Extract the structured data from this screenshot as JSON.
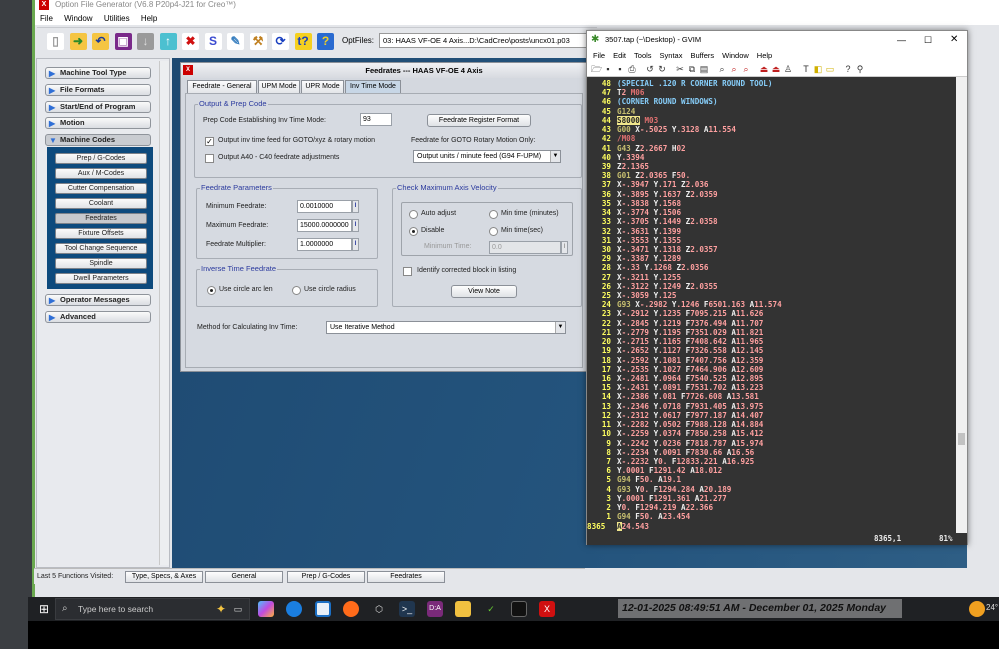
{
  "ofg": {
    "title": "Option File Generator (V6.8 P20p4-J21 for Creo™)",
    "menu": [
      "File",
      "Window",
      "Utilities",
      "Help"
    ],
    "toolbar_icons": [
      "new-file-icon",
      "open-folder-icon",
      "undo-folder-icon",
      "save-icon",
      "download-icon",
      "upload-icon",
      "delete-icon",
      "script-icon",
      "edit-icon",
      "tools-icon",
      "refresh-icon",
      "context-help-icon",
      "help-icon"
    ],
    "optfiles_label": "OptFiles:",
    "optfiles_value": "03:  HAAS VF-OE 4 Axis...D:\\CadCreo\\posts\\uncx01.p03",
    "nav": [
      {
        "label": "Machine Tool Type"
      },
      {
        "label": "File Formats"
      },
      {
        "label": "Start/End of Program"
      },
      {
        "label": "Motion"
      },
      {
        "label": "Machine Codes",
        "expanded": true
      },
      {
        "label": "Operator Messages"
      },
      {
        "label": "Advanced"
      }
    ],
    "subnav": [
      "Prep / G-Codes",
      "Aux / M-Codes",
      "Cutter Compensation",
      "Coolant",
      "Feedrates",
      "Fixture Offsets",
      "Tool Change Sequence",
      "Spindle",
      "Dwell Parameters"
    ],
    "subnav_selected": "Feedrates",
    "last_label": "Last 5 Functions Visited:",
    "last": [
      "Type, Specs, & Axes",
      "General",
      "Prep / G-Codes",
      "Feedrates"
    ]
  },
  "frame": {
    "title": "Feedrates --- HAAS VF-OE 4 Axis",
    "tabs": [
      "Feedrate - General",
      "UPM Mode",
      "UPR Mode",
      "Inv Time Mode"
    ],
    "active_tab": "Inv Time Mode",
    "output_group": "Output & Prep Code",
    "prep_label": "Prep Code Establishing Inv Time Mode:",
    "prep_value": "93",
    "register_btn": "Feedrate Register Format",
    "chk_inv": "Output inv time feed for GOTO/xyz & rotary motion",
    "chk_inv_checked": true,
    "chk_a40": "Output A40 - C40 feedrate adjustments",
    "chk_a40_checked": false,
    "goto_label": "Feedrate for GOTO Rotary Motion Only:",
    "goto_value": "Output units / minute feed (G94 F-UPM)",
    "params_group": "Feedrate Parameters",
    "min_label": "Minimum Feedrate:",
    "min_value": "0.0010000",
    "max_label": "Maximum Feedrate:",
    "max_value": "15000.0000000",
    "mult_label": "Feedrate Multiplier:",
    "mult_value": "1.0000000",
    "vel_group": "Check Maximum Axis Velocity",
    "r_auto": "Auto adjust",
    "r_minmin": "Min time (minutes)",
    "r_disable": "Disable",
    "r_minsec": "Min time(sec)",
    "vel_selected": "Disable",
    "mintime_label": "Minimum Time:",
    "mintime_value": "0.0",
    "chk_identify": "Identify corrected block in listing",
    "chk_identify_checked": false,
    "viewnote_btn": "View Note",
    "inv_group": "Inverse Time Feedrate",
    "r_arc": "Use circle arc len",
    "r_radius": "Use circle radius",
    "inv_selected": "Use circle arc len",
    "method_label": "Method for Calculating Inv Time:",
    "method_value": "Use Iterative Method"
  },
  "gvim": {
    "title": "3507.tap (~\\Desktop) - GVIM",
    "menu": [
      "File",
      "Edit",
      "Tools",
      "Syntax",
      "Buffers",
      "Window",
      "Help"
    ],
    "lines": [
      [
        "48",
        "(SPECIAL .120 R CORNER ROUND TOOL)"
      ],
      [
        "47",
        "T2 M06"
      ],
      [
        "46",
        "(CORNER ROUND WINDOWS)"
      ],
      [
        "45",
        "G124"
      ],
      [
        "44",
        "S8000 M03"
      ],
      [
        "43",
        "G00 X-.5025 Y.3128 A11.554"
      ],
      [
        "42",
        "/M08"
      ],
      [
        "41",
        "G43 Z2.2667 H02"
      ],
      [
        "40",
        "Y.3394"
      ],
      [
        "39",
        "Z2.1365"
      ],
      [
        "38",
        "G01 Z2.0365 F50."
      ],
      [
        "37",
        "X-.3947 Y.171 Z2.036"
      ],
      [
        "36",
        "X-.3895 Y.1637 Z2.0359"
      ],
      [
        "35",
        "X-.3838 Y.1568"
      ],
      [
        "34",
        "X-.3774 Y.1506"
      ],
      [
        "33",
        "X-.3705 Y.1449 Z2.0358"
      ],
      [
        "32",
        "X-.3631 Y.1399"
      ],
      [
        "31",
        "X-.3553 Y.1355"
      ],
      [
        "30",
        "X-.3471 Y.1318 Z2.0357"
      ],
      [
        "29",
        "X-.3387 Y.1289"
      ],
      [
        "28",
        "X-.33 Y.1268 Z2.0356"
      ],
      [
        "27",
        "X-.3211 Y.1255"
      ],
      [
        "26",
        "X-.3122 Y.1249 Z2.0355"
      ],
      [
        "25",
        "X-.3059 Y.125"
      ],
      [
        "24",
        "G93 X-.2982 Y.1246 F6501.163 A11.574"
      ],
      [
        "23",
        "X-.2912 Y.1235 F7095.215 A11.626"
      ],
      [
        "22",
        "X-.2845 Y.1219 F7376.494 A11.707"
      ],
      [
        "21",
        "X-.2779 Y.1195 F7351.029 A11.821"
      ],
      [
        "20",
        "X-.2715 Y.1165 F7408.642 A11.965"
      ],
      [
        "19",
        "X-.2652 Y.1127 F7326.558 A12.145"
      ],
      [
        "18",
        "X-.2592 Y.1081 F7407.756 A12.359"
      ],
      [
        "17",
        "X-.2535 Y.1027 F7464.906 A12.609"
      ],
      [
        "16",
        "X-.2481 Y.0964 F7540.525 A12.895"
      ],
      [
        "15",
        "X-.2431 Y.0891 F7531.702 A13.223"
      ],
      [
        "14",
        "X-.2386 Y.081 F7726.608 A13.581"
      ],
      [
        "13",
        "X-.2346 Y.0718 F7931.405 A13.975"
      ],
      [
        "12",
        "X-.2312 Y.0617 F7977.187 A14.407"
      ],
      [
        "11",
        "X-.2282 Y.0502 F7988.128 A14.884"
      ],
      [
        "10",
        "X-.2259 Y.0374 F7850.258 A15.412"
      ],
      [
        "9",
        "X-.2242 Y.0236 F7818.787 A15.974"
      ],
      [
        "8",
        "X-.2234 Y.0091 F7830.66 A16.56"
      ],
      [
        "7",
        "X-.2232 Y0. F12833.221 A16.925"
      ],
      [
        "6",
        "Y.0001 F1291.42 A18.012"
      ],
      [
        "5",
        "G94 F50. A19.1"
      ],
      [
        "4",
        "G93 Y0. F1294.284 A20.189"
      ],
      [
        "3",
        "Y.0001 F1291.361 A21.277"
      ],
      [
        "2",
        "Y0. F1294.219 A22.366"
      ],
      [
        "1",
        "G94 F50. A23.454"
      ],
      [
        "8365",
        "A24.543"
      ]
    ],
    "cursor_line": "8365",
    "status_pos": "8365,1",
    "status_pct": "81%"
  },
  "taskbar": {
    "search_placeholder": "Type here to search",
    "clock": "12-01-2025 08:49:51 AM - December 01, 2025 Monday",
    "weather": "24°"
  }
}
